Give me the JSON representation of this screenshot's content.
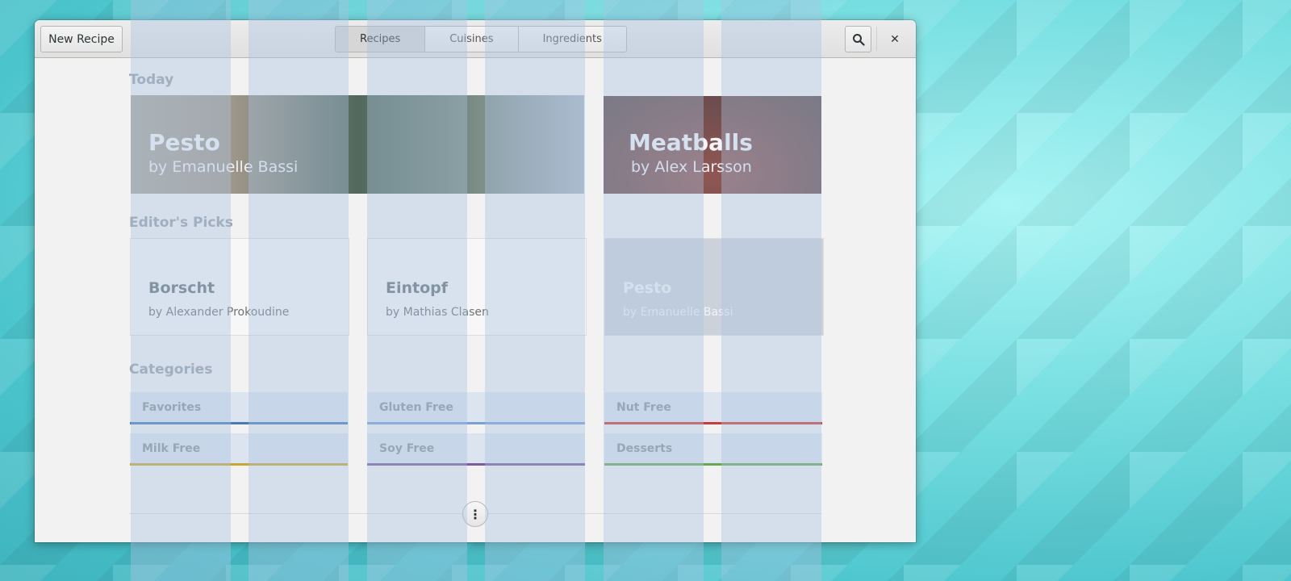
{
  "header": {
    "new_recipe_label": "New Recipe",
    "tabs": [
      {
        "label": "Recipes",
        "active": true
      },
      {
        "label": "Cuisines",
        "active": false
      },
      {
        "label": "Ingredients",
        "active": false
      }
    ],
    "search_icon": "search-icon",
    "close_glyph": "✕"
  },
  "today": {
    "title": "Today",
    "cards": [
      {
        "title": "Pesto",
        "author": "by Emanuelle Bassi"
      },
      {
        "title": "Meatballs",
        "author": "by Alex Larsson"
      }
    ]
  },
  "picks": {
    "title": "Editor's Picks",
    "cards": [
      {
        "title": "Borscht",
        "author": "by Alexander Prokoudine"
      },
      {
        "title": "Eintopf",
        "author": "by Mathias Clasen"
      },
      {
        "title": "Pesto",
        "author": "by Emanuelle Bassi"
      }
    ]
  },
  "categories": {
    "title": "Categories",
    "items": [
      {
        "label": "Favorites",
        "color": "#4a7ab5"
      },
      {
        "label": "Gluten Free",
        "color": "#7aa0d8"
      },
      {
        "label": "Nut Free",
        "color": "#cc3b3b"
      },
      {
        "label": "Milk Free",
        "color": "#c7a635"
      },
      {
        "label": "Soy Free",
        "color": "#7b5c9e"
      },
      {
        "label": "Desserts",
        "color": "#6aa84f"
      }
    ]
  },
  "more_glyph": "⋮"
}
